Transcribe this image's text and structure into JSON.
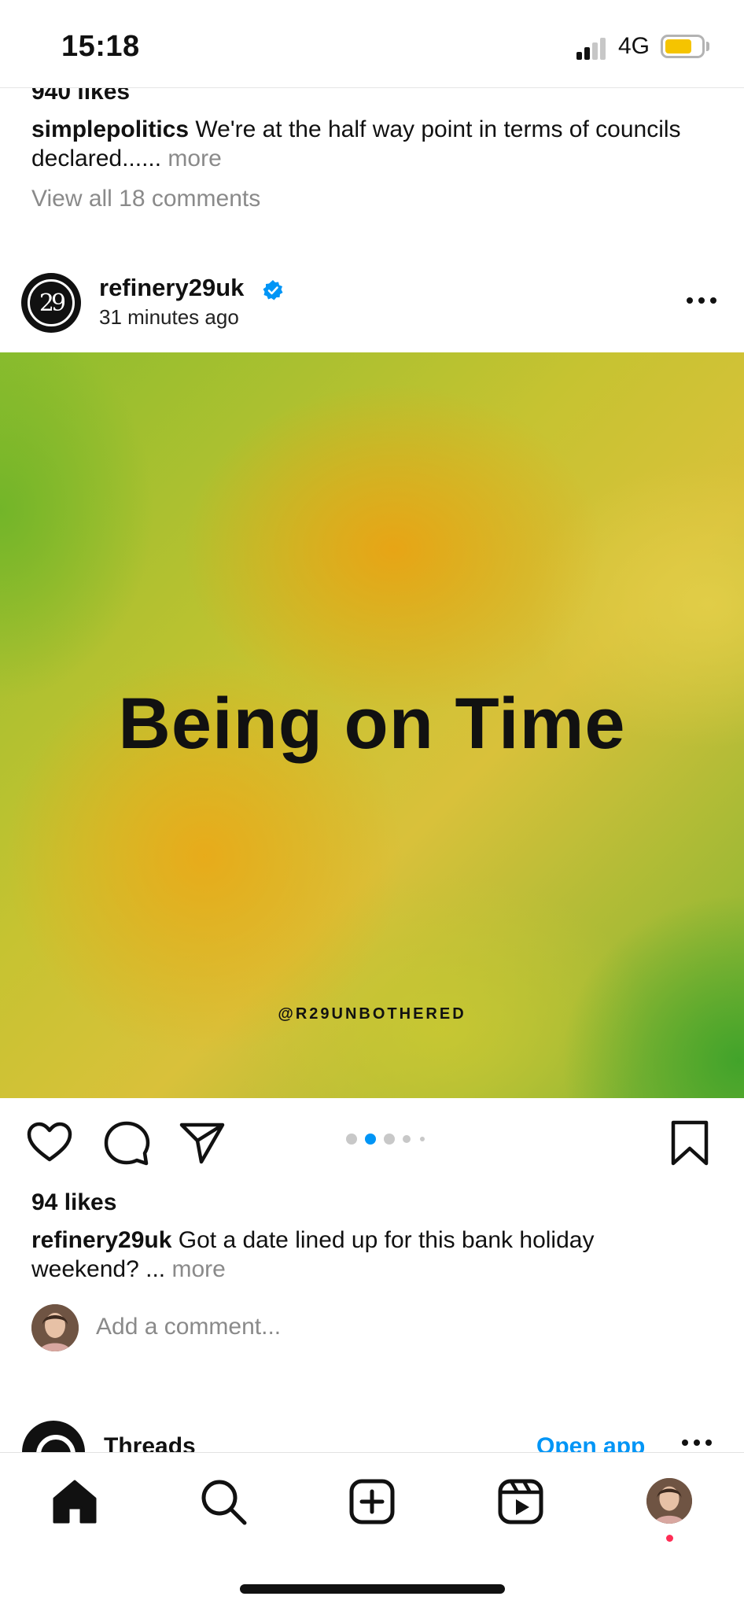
{
  "status_bar": {
    "time": "15:18",
    "network": "4G",
    "battery_level": 0.75,
    "battery_color": "#f5c400",
    "signal_bars_active": 2,
    "signal_bars_total": 4
  },
  "previous_post": {
    "likes": "940 likes",
    "caption_user": "simplepolitics",
    "caption_text": " We're at the half way point in terms of councils declared......",
    "more_label": " more",
    "view_comments": "View all 18 comments"
  },
  "post": {
    "username": "refinery29uk",
    "verified_icon": "verified-badge-icon",
    "time_ago": "31 minutes ago",
    "options_label": "...",
    "image": {
      "title": "Being on Time",
      "handle": "@R29UNBOTHERED"
    },
    "carousel": {
      "count": 5,
      "active_index": 1,
      "accent": "#0095f6"
    },
    "likes": "94 likes",
    "caption_user": "refinery29uk",
    "caption_text": " Got a date lined up for this bank holiday weekend? ...",
    "more_label": " more",
    "comment_placeholder": "Add a comment..."
  },
  "threads_suggestion": {
    "name": "Threads",
    "action_label": "Open app",
    "options_label": "..."
  },
  "nav": {
    "items": [
      "home-icon",
      "search-icon",
      "create-post-icon",
      "reels-icon",
      "profile-avatar"
    ]
  },
  "colors": {
    "link_blue": "#0095f6",
    "muted_text": "#8a8a8a",
    "notification": "#ff2d55"
  }
}
